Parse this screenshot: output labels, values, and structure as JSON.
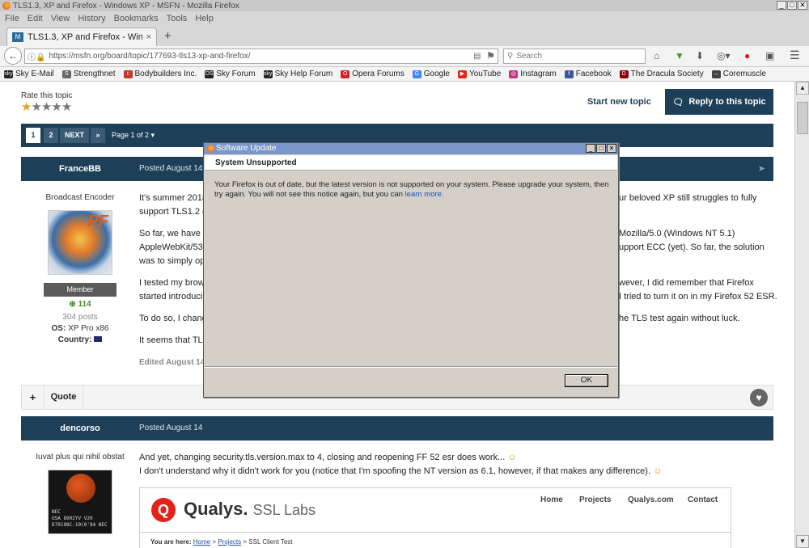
{
  "window": {
    "title": "TLS1.3, XP and Firefox - Windows XP - MSFN - Mozilla Firefox",
    "controls": [
      "_",
      "□",
      "✕"
    ]
  },
  "menu": [
    "File",
    "Edit",
    "View",
    "History",
    "Bookmarks",
    "Tools",
    "Help"
  ],
  "tab": {
    "title": "TLS1.3, XP and Firefox - Windo...",
    "close": "×",
    "new_tab": "+"
  },
  "address": {
    "url": "https://msfn.org/board/topic/177693-tls13-xp-and-firefox/",
    "search_placeholder": "Search"
  },
  "bookmarks": [
    {
      "label": "Sky E-Mail",
      "icon": "sky-icon",
      "color": "#222222",
      "glyph": "sky"
    },
    {
      "label": "Strengthnet",
      "icon": "strengthnet-icon",
      "color": "#666666",
      "glyph": "S"
    },
    {
      "label": "Bodybuilders Inc.",
      "icon": "bodybuilders-icon",
      "color": "#c0392b",
      "glyph": "t"
    },
    {
      "label": "Sky Forum",
      "icon": "ds-icon",
      "color": "#222222",
      "glyph": "DS"
    },
    {
      "label": "Sky Help Forum",
      "icon": "sky-icon",
      "color": "#222222",
      "glyph": "sky"
    },
    {
      "label": "Opera Forums",
      "icon": "opera-icon",
      "color": "#d41f27",
      "glyph": "O"
    },
    {
      "label": "Google",
      "icon": "google-icon",
      "color": "#4285f4",
      "glyph": "G"
    },
    {
      "label": "YouTube",
      "icon": "youtube-icon",
      "color": "#e62117",
      "glyph": "▶"
    },
    {
      "label": "Instagram",
      "icon": "instagram-icon",
      "color": "#c13584",
      "glyph": "◎"
    },
    {
      "label": "Facebook",
      "icon": "facebook-icon",
      "color": "#3b5998",
      "glyph": "f"
    },
    {
      "label": "The Dracula Society",
      "icon": "dracula-icon",
      "color": "#8b0000",
      "glyph": "D"
    },
    {
      "label": "Coremuscle",
      "icon": "coremuscle-icon",
      "color": "#444444",
      "glyph": "↔"
    }
  ],
  "topic": {
    "rate_label": "Rate this topic",
    "rating": 1,
    "start_new": "Start new topic",
    "reply": "Reply to this topic",
    "pager": {
      "page1": "1",
      "page2": "2",
      "next": "NEXT",
      "last": "»",
      "page_of": "Page 1 of 2 ▾"
    }
  },
  "post1": {
    "author": "FranceBB",
    "date": "Posted August 14",
    "title": "Broadcast Encoder",
    "group": "Member",
    "reputation": "114",
    "posts": "304 posts",
    "os_label": "OS:",
    "os_value": "XP Pro x86",
    "country_label": "Country:",
    "line1a": "It's summer 2018",
    "line1b": "ur beloved XP still struggles to fully",
    "line2": "support TLS1.2 du",
    "line3a": "So far, we have b",
    "line3b": "Mozilla/5.0 (Windows NT 5.1)",
    "line4a": "AppleWebKit/537",
    "line4b": "upport ECC (yet). So far, the solution",
    "line5": "was to simply op",
    "line6a": "I tested my brows",
    "line6b": "wever, I did remember that Firefox",
    "line7a": "started introducin",
    "line7b": "I tried to turn it on in my Firefox 52 ESR.",
    "line8a": "To do so, I chang",
    "line8b": "he TLS test again without luck.",
    "line9": "It seems that TLS",
    "edited": "Edited August 14"
  },
  "actions": {
    "plus": "+",
    "quote": "Quote"
  },
  "post2": {
    "author": "dencorso",
    "date": "Posted August 14",
    "title": "Iuvat plus qui nihil obstat",
    "line1": "And yet, changing security.tls.version.max to 4, closing and reopening FF 52 esr does work... ",
    "line2": "I don't understand why it didn't work for you (notice that I'm spoofing the NT version as 6.1, however, if that makes any difference). ",
    "avatar_chip": [
      "NEC",
      "USA   8902YV  V20",
      "D70108C-10(0'84 NEC"
    ]
  },
  "qualys": {
    "logo_text": "Q",
    "brand": "Qualys.",
    "brand_sub": "SSL Labs",
    "nav": [
      "Home",
      "Projects",
      "Qualys.com",
      "Contact"
    ],
    "crumb_prefix": "You are here:",
    "crumb_home": "Home",
    "crumb_sep1": " > ",
    "crumb_projects": "Projects",
    "crumb_rest": " > SSL Client Test"
  },
  "dialog": {
    "title": "Software Update",
    "heading": "System Unsupported",
    "message": "Your Firefox is out of date, but the latest version is not supported on your system. Please upgrade your system, then try again. You will not see this notice again, but you can ",
    "link": "learn more.",
    "ok": "OK"
  }
}
